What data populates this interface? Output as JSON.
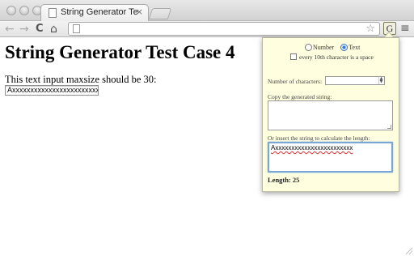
{
  "browser": {
    "tab_title": "String Generator Test Case",
    "tab_close": "×",
    "back_glyph": "←",
    "forward_glyph": "→",
    "reload_glyph": "C",
    "home_glyph": "⌂",
    "star_glyph": "☆",
    "extension_glyph": "G",
    "menu_glyph": "≡"
  },
  "page": {
    "title": "String Generator Test Case 4",
    "text": "This text input maxsize should be 30:",
    "input_value": "Axxxxxxxxxxxxxxxxxxxxxxxx"
  },
  "popup": {
    "radio_number": "Number",
    "radio_text": "Text",
    "checkbox_label": "every 10th character is a space",
    "num_chars_label": "Number of characters:",
    "copy_label": "Copy the generated string:",
    "insert_label": "Or insert the string to calculate the length:",
    "insert_value": "Axxxxxxxxxxxxxxxxxxxxxxxx",
    "length_text": "Length: 25",
    "selected_mode": "Text"
  }
}
